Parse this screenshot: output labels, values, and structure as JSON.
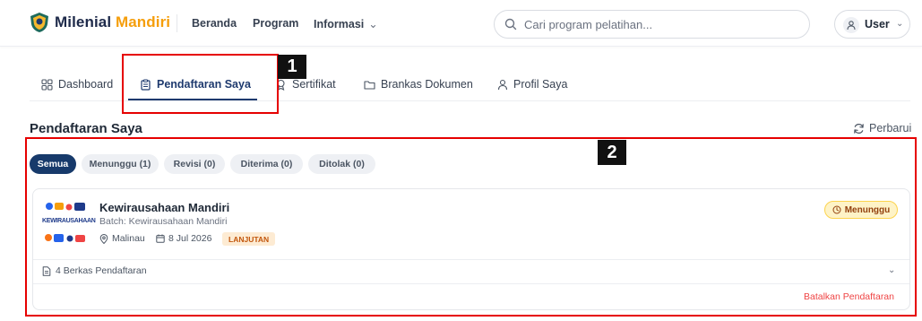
{
  "header": {
    "brand_part1": "Milenial",
    "brand_part2": "Mandiri",
    "nav": [
      "Beranda",
      "Program",
      "Informasi"
    ],
    "search_placeholder": "Cari program pelatihan...",
    "user_label": "User"
  },
  "tabs": [
    {
      "label": "Dashboard",
      "icon": "grid-icon"
    },
    {
      "label": "Pendaftaran Saya",
      "icon": "clipboard-icon",
      "active": true
    },
    {
      "label": "Sertifikat",
      "icon": "award-icon"
    },
    {
      "label": "Brankas Dokumen",
      "icon": "folder-icon"
    },
    {
      "label": "Profil Saya",
      "icon": "user-icon"
    }
  ],
  "section": {
    "title": "Pendaftaran Saya",
    "refresh_label": "Perbarui"
  },
  "filters": [
    "Semua",
    "Menunggu (1)",
    "Revisi (0)",
    "Diterima (0)",
    "Ditolak (0)"
  ],
  "registration": {
    "thumb_text": "KEWIRAUSAHAAN",
    "title": "Kewirausahaan Mandiri",
    "batch": "Batch: Kewirausahaan Mandiri",
    "location": "Malinau",
    "date": "8 Jul 2026",
    "level": "LANJUTAN",
    "status": "Menunggu",
    "files": "4 Berkas Pendaftaran",
    "cancel_label": "Batalkan Pendaftaran"
  },
  "annotations": [
    "1",
    "2"
  ],
  "colors": {
    "primary": "#173a6b",
    "accent": "#f59e0b",
    "annotation": "#e60000",
    "danger": "#ef4444"
  }
}
